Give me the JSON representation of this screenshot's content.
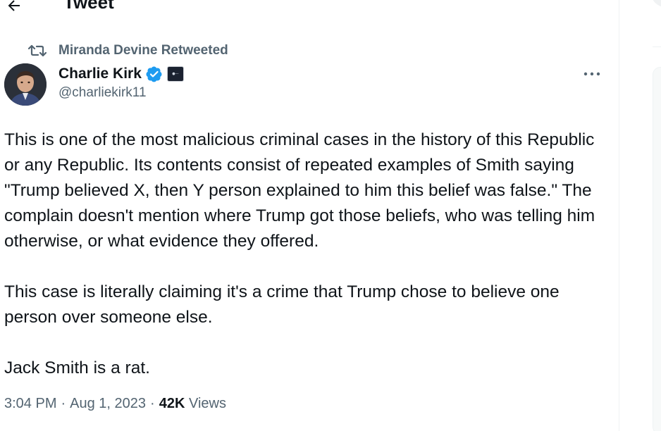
{
  "header": {
    "title": "Tweet"
  },
  "retweet": {
    "label": "Miranda Devine Retweeted"
  },
  "author": {
    "name": "Charlie Kirk",
    "handle": "@charliekirk11",
    "verified_color": "#1d9bf0"
  },
  "tweet": {
    "paragraphs": [
      "This is one of the most malicious criminal cases in the history of this Republic or any Republic. Its contents consist of repeated examples of Smith saying \"Trump believed X, then Y person explained to him this belief was false.\" The complain doesn't mention where Trump got those beliefs, who was telling him otherwise, or what evidence they offered.",
      "This case is literally claiming it's a crime that Trump chose to believe one person over someone else.",
      "Jack Smith is a rat."
    ],
    "time": "3:04 PM",
    "date": "Aug 1, 2023",
    "views_count": "42K",
    "views_label": "Views",
    "separator": "·"
  },
  "icons": {
    "back": "arrow-left-icon",
    "retweet": "retweet-icon",
    "verified": "verified-badge-icon",
    "more": "more-horizontal-icon"
  }
}
